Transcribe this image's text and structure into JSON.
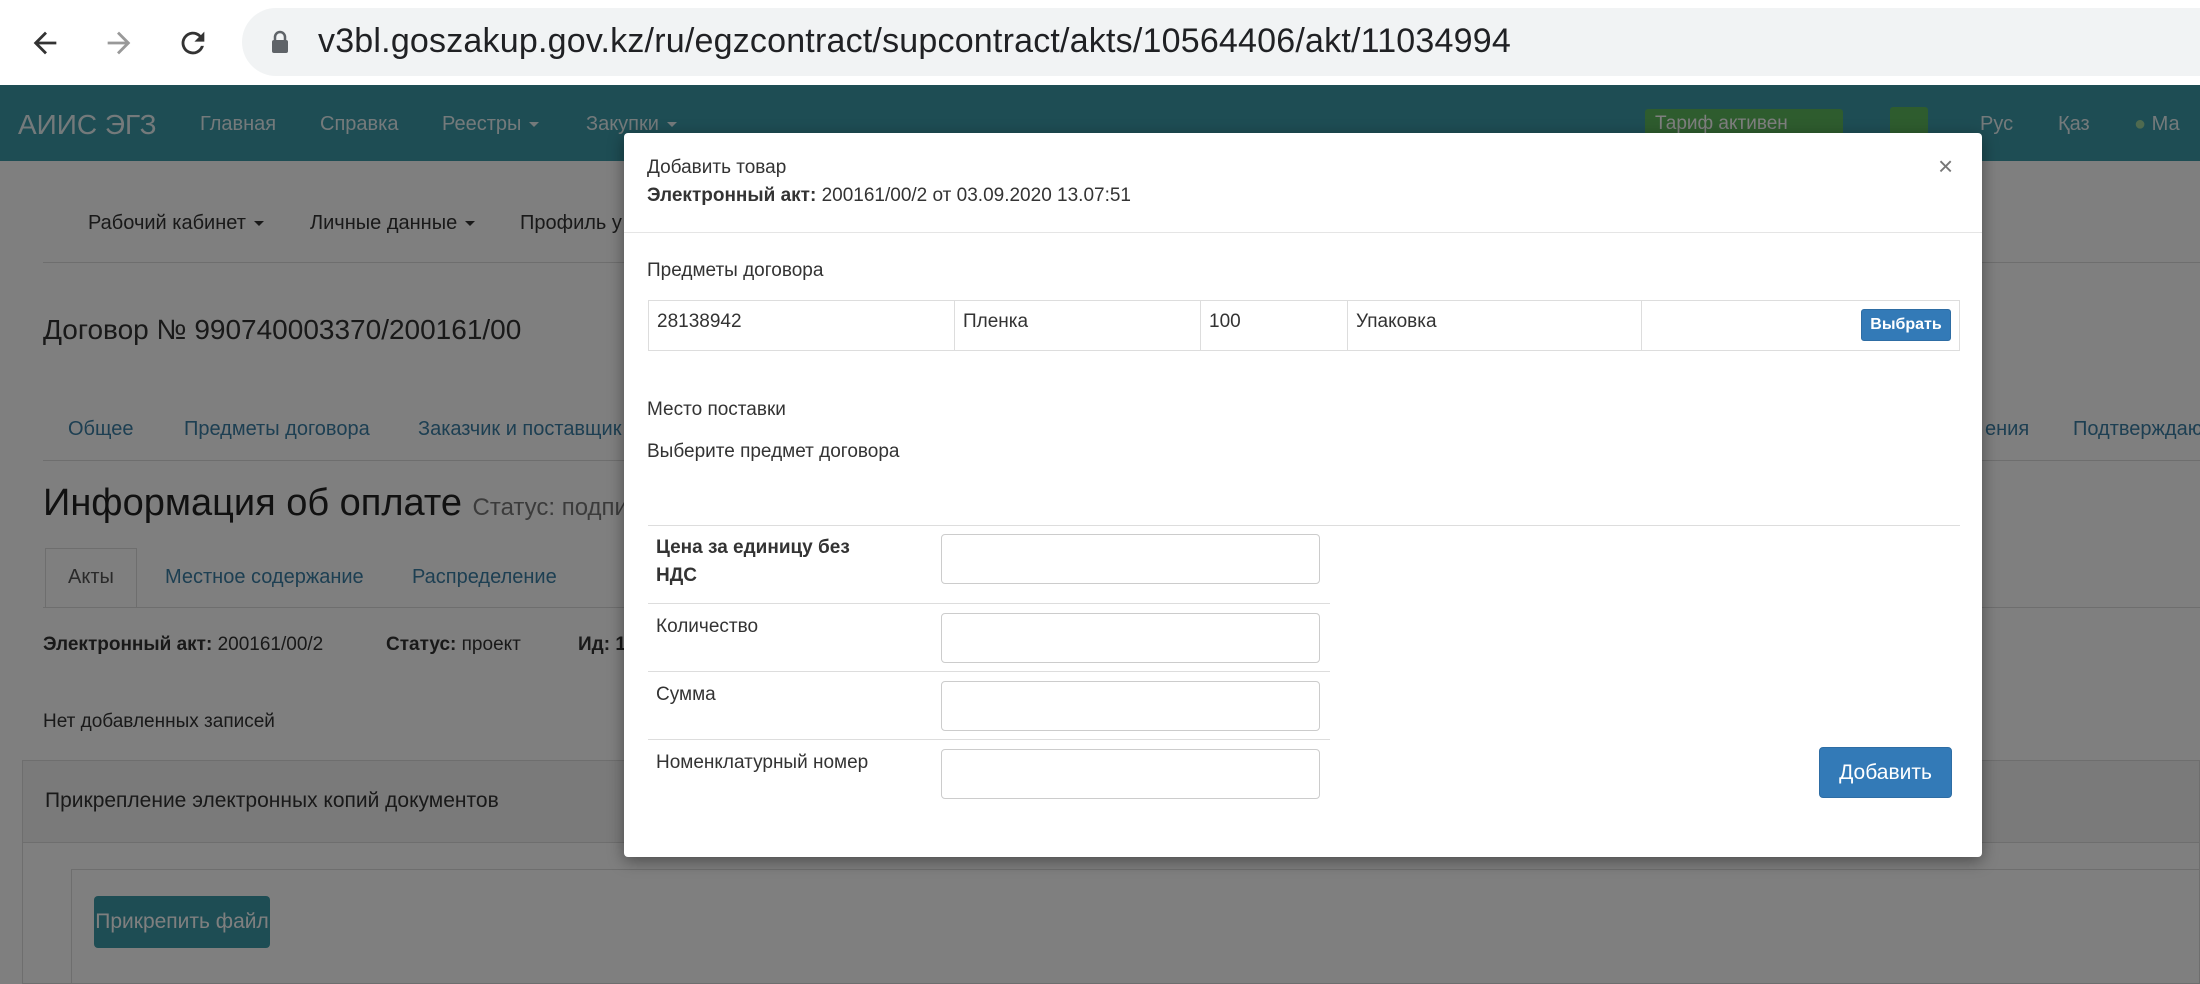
{
  "browser": {
    "url": "v3bl.goszakup.gov.kz/ru/egzcontract/supcontract/akts/10564406/akt/11034994"
  },
  "navbar": {
    "brand": "АИИС ЭГЗ",
    "items": [
      "Главная",
      "Справка",
      "Реестры",
      "Закупки"
    ],
    "tariff": "Тариф активен",
    "lang_ru": "Рус",
    "lang_kz": "Қаз",
    "user": "Ма"
  },
  "subnav": {
    "items": [
      "Рабочий кабинет",
      "Личные данные",
      "Профиль у"
    ]
  },
  "page": {
    "contract_title": "Договор № 990740003370/200161/00",
    "tabs": [
      "Общее",
      "Предметы договора",
      "Заказчик и поставщик",
      "ения",
      "Подтверждаю"
    ],
    "heading": "Информация об оплате",
    "status_prefix": "Статус: подписа",
    "subtabs": [
      "Акты",
      "Местное содержание",
      "Распределение"
    ],
    "info": {
      "akt_label": "Электронный акт:",
      "akt_value": "200161/00/2",
      "status_label": "Статус:",
      "status_value": "проект",
      "id_label": "Ид: 1"
    },
    "no_records": "Нет добавленных записей",
    "attach_title": "Прикрепление электронных копий документов",
    "attach_button": "Прикрепить файл"
  },
  "modal": {
    "title": "Добавить товар",
    "subtitle_label": "Электронный акт:",
    "subtitle_value": "200161/00/2 от 03.09.2020 13.07:51",
    "close": "×",
    "items_label": "Предметы договора",
    "item": {
      "code": "28138942",
      "name": "Пленка",
      "qty": "100",
      "unit": "Упаковка",
      "select_button": "Выбрать"
    },
    "delivery_label": "Место поставки",
    "delivery_hint": "Выберите предмет договора",
    "fields": {
      "price_label": "Цена за единицу без НДС",
      "quantity_label": "Количество",
      "sum_label": "Сумма",
      "nomenclature_label": "Номенклатурный номер"
    },
    "add_button": "Добавить"
  }
}
